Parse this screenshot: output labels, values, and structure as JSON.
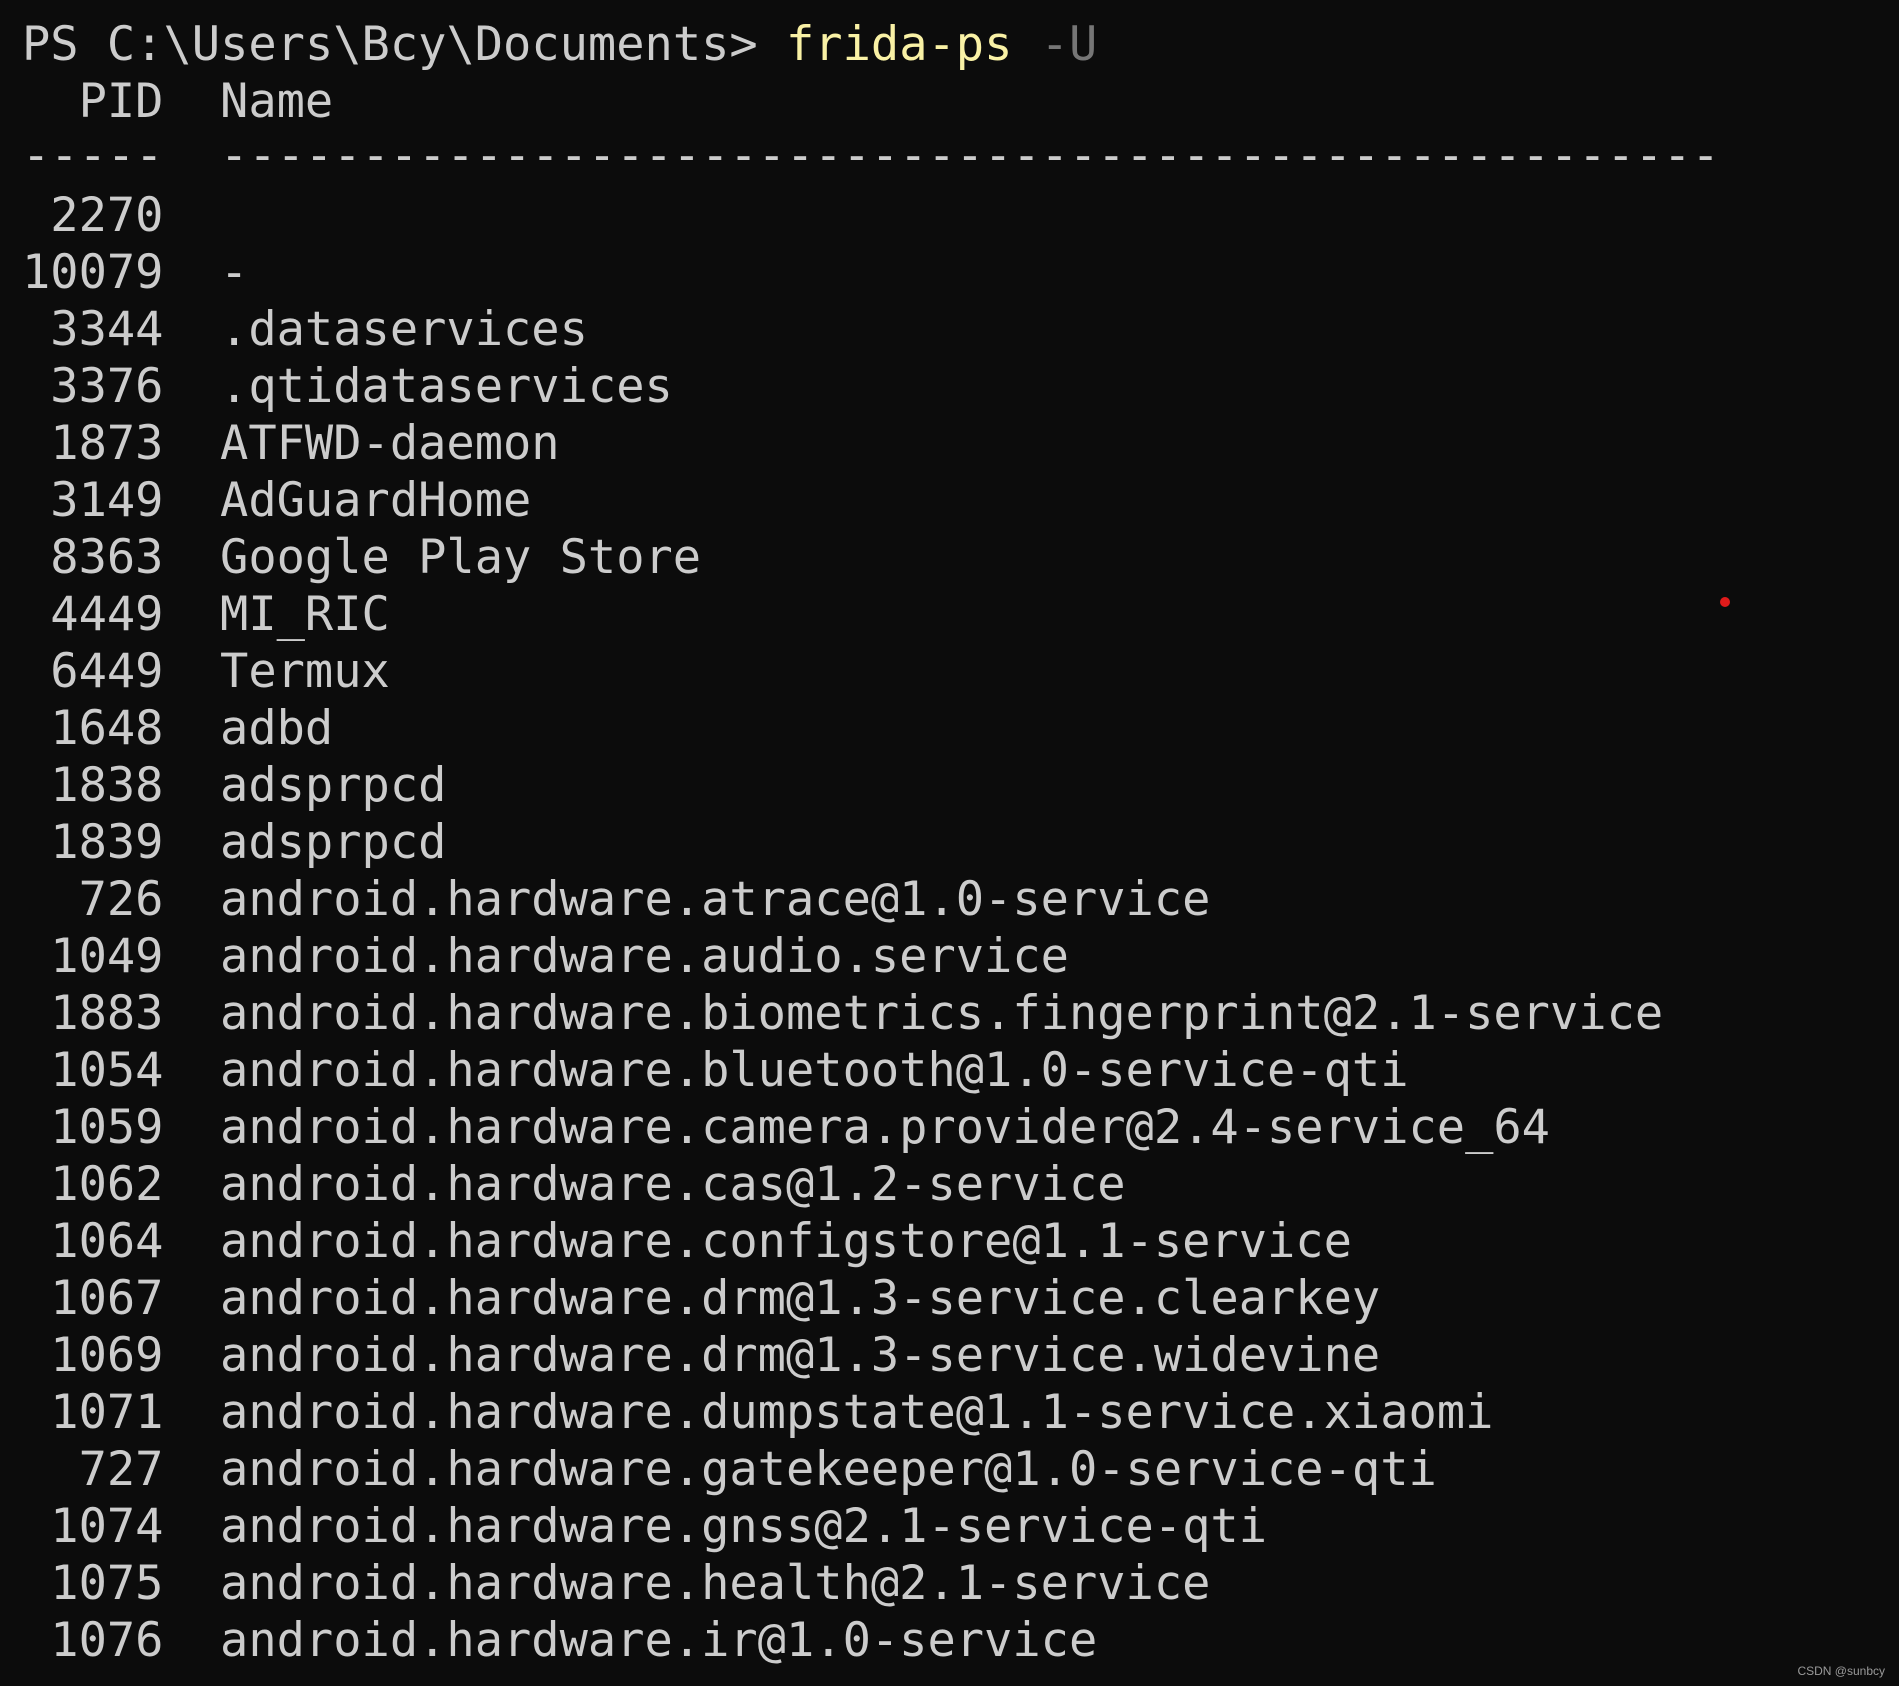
{
  "prompt": {
    "text": "PS C:\\Users\\Bcy\\Documents> ",
    "command": "frida-ps",
    "param": " -U"
  },
  "header": {
    "pid_label": "PID",
    "name_label": "Name",
    "pid_rule": "-----",
    "name_rule": "-----------------------------------------------------"
  },
  "rows": [
    {
      "pid": "2270",
      "name": ""
    },
    {
      "pid": "10079",
      "name": "-"
    },
    {
      "pid": "3344",
      "name": ".dataservices"
    },
    {
      "pid": "3376",
      "name": ".qtidataservices"
    },
    {
      "pid": "1873",
      "name": "ATFWD-daemon"
    },
    {
      "pid": "3149",
      "name": "AdGuardHome"
    },
    {
      "pid": "8363",
      "name": "Google Play Store"
    },
    {
      "pid": "4449",
      "name": "MI_RIC"
    },
    {
      "pid": "6449",
      "name": "Termux"
    },
    {
      "pid": "1648",
      "name": "adbd"
    },
    {
      "pid": "1838",
      "name": "adsprpcd"
    },
    {
      "pid": "1839",
      "name": "adsprpcd"
    },
    {
      "pid": "726",
      "name": "android.hardware.atrace@1.0-service"
    },
    {
      "pid": "1049",
      "name": "android.hardware.audio.service"
    },
    {
      "pid": "1883",
      "name": "android.hardware.biometrics.fingerprint@2.1-service"
    },
    {
      "pid": "1054",
      "name": "android.hardware.bluetooth@1.0-service-qti"
    },
    {
      "pid": "1059",
      "name": "android.hardware.camera.provider@2.4-service_64"
    },
    {
      "pid": "1062",
      "name": "android.hardware.cas@1.2-service"
    },
    {
      "pid": "1064",
      "name": "android.hardware.configstore@1.1-service"
    },
    {
      "pid": "1067",
      "name": "android.hardware.drm@1.3-service.clearkey"
    },
    {
      "pid": "1069",
      "name": "android.hardware.drm@1.3-service.widevine"
    },
    {
      "pid": "1071",
      "name": "android.hardware.dumpstate@1.1-service.xiaomi"
    },
    {
      "pid": "727",
      "name": "android.hardware.gatekeeper@1.0-service-qti"
    },
    {
      "pid": "1074",
      "name": "android.hardware.gnss@2.1-service-qti"
    },
    {
      "pid": "1075",
      "name": "android.hardware.health@2.1-service"
    },
    {
      "pid": "1076",
      "name": "android.hardware.ir@1.0-service"
    }
  ],
  "watermark": "CSDN @sunbcy",
  "colors": {
    "background": "#0c0c0c",
    "foreground": "#cccccc",
    "command": "#f9f1a5",
    "parameter": "#767676",
    "cursor_dot": "#e01b1b"
  }
}
